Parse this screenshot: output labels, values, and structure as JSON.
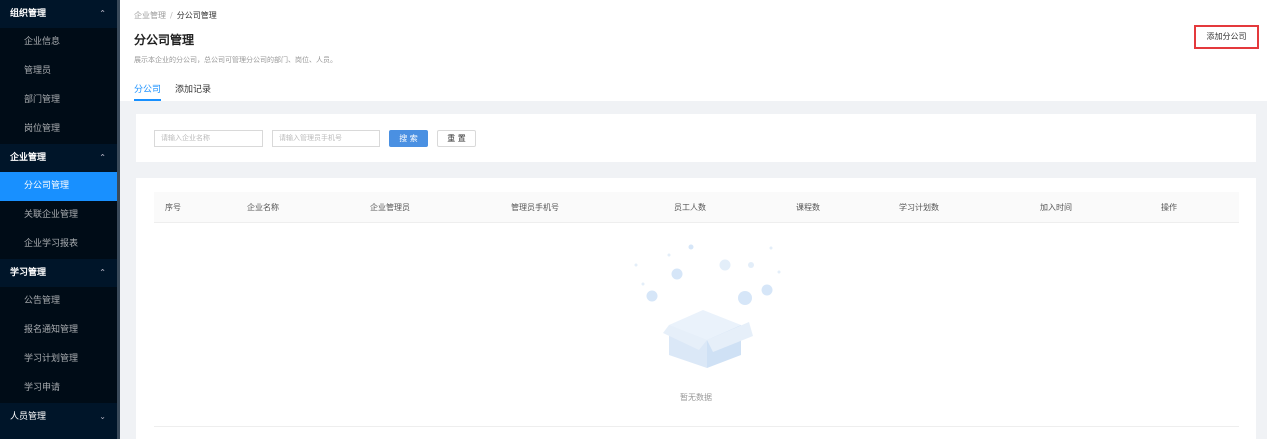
{
  "sidebar": {
    "groups": [
      {
        "label": "组织管理",
        "items": [
          "企业信息",
          "管理员",
          "部门管理",
          "岗位管理"
        ]
      },
      {
        "label": "企业管理",
        "items": [
          "分公司管理",
          "关联企业管理",
          "企业学习报表"
        ]
      },
      {
        "label": "学习管理",
        "items": [
          "公告管理",
          "报名通知管理",
          "学习计划管理",
          "学习申请"
        ]
      },
      {
        "label": "人员管理",
        "items": []
      }
    ],
    "active_item": "分公司管理"
  },
  "breadcrumb": {
    "parent": "企业管理",
    "separator": "/",
    "current": "分公司管理"
  },
  "page": {
    "title": "分公司管理",
    "description": "展示本企业的分公司，总公司可管理分公司的部门、岗位、人员。",
    "add_button": "添加分公司"
  },
  "tabs": [
    {
      "label": "分公司",
      "active": true
    },
    {
      "label": "添加记录",
      "active": false
    }
  ],
  "filters": {
    "company_name_placeholder": "请输入企业名称",
    "admin_phone_placeholder": "请输入管理员手机号",
    "search_button": "搜 索",
    "reset_button": "重 置"
  },
  "table": {
    "columns": [
      "序号",
      "企业名称",
      "企业管理员",
      "管理员手机号",
      "员工人数",
      "课程数",
      "学习计划数",
      "加入时间",
      "操作"
    ],
    "rows": [],
    "empty_text": "暂无数据"
  },
  "colors": {
    "sidebar_bg": "#001529",
    "accent": "#1890ff",
    "highlight_border": "#e4393c"
  }
}
